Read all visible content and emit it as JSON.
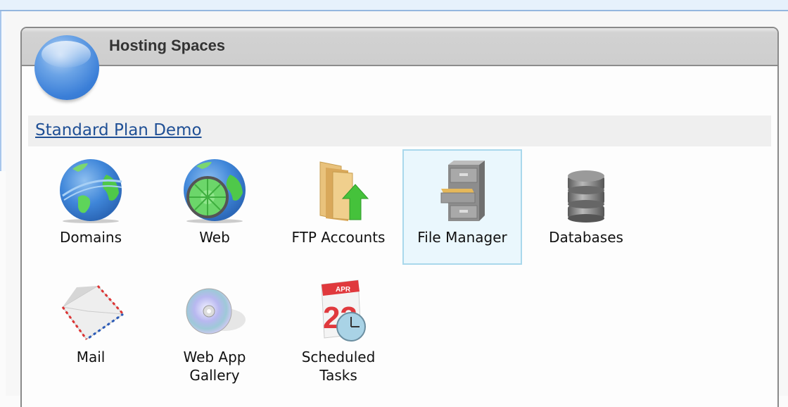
{
  "panel": {
    "title": "Hosting Spaces",
    "plan_link": "Standard Plan Demo"
  },
  "tiles": [
    {
      "label": "Domains",
      "icon": "globe-icon",
      "selected": false
    },
    {
      "label": "Web",
      "icon": "web-globe-icon",
      "selected": false
    },
    {
      "label": "FTP Accounts",
      "icon": "ftp-folder-upload-icon",
      "selected": false
    },
    {
      "label": "File Manager",
      "icon": "file-cabinet-icon",
      "selected": true
    },
    {
      "label": "Databases",
      "icon": "database-icon",
      "selected": false
    },
    {
      "label": "Mail",
      "icon": "envelope-icon",
      "selected": false
    },
    {
      "label": "Web App\nGallery",
      "label_line1": "Web App",
      "label_line2": "Gallery",
      "icon": "cd-disc-icon",
      "selected": false
    },
    {
      "label": "Scheduled\nTasks",
      "label_line1": "Scheduled",
      "label_line2": "Tasks",
      "icon": "calendar-clock-icon",
      "selected": false
    }
  ],
  "colors": {
    "link": "#1f4f95",
    "selected_bg": "#eaf7fd",
    "selected_border": "#a9d8ec",
    "header_bg": "#cecece"
  }
}
